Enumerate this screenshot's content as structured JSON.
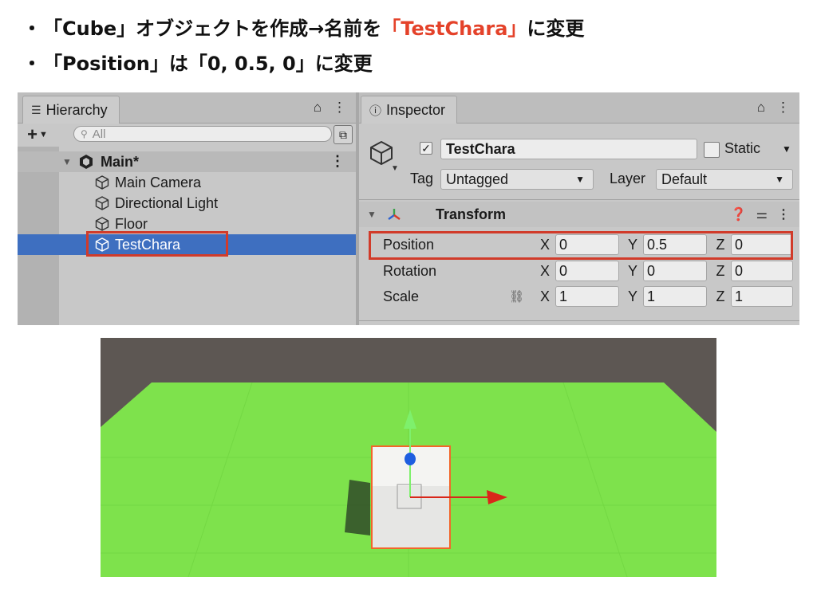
{
  "instructions": {
    "line1": {
      "bullet": "・",
      "text_before": "「Cube」オブジェクトを作成→名前を",
      "highlight": "「TestChara」",
      "text_after": "に変更"
    },
    "line2": {
      "bullet": "・",
      "text": "「Position」は「0, 0.5, 0」に変更"
    },
    "highlight_color": "#e4422a"
  },
  "hierarchy": {
    "tab_label": "Hierarchy",
    "tab_icon": "list-icon",
    "lock_glyph": "⌂",
    "menu_glyph": "⋮",
    "add_label": "+",
    "search_placeholder": "All",
    "scene_name": "Main*",
    "items": [
      {
        "label": "Main Camera",
        "icon": "cube-icon"
      },
      {
        "label": "Directional Light",
        "icon": "cube-icon"
      },
      {
        "label": "Floor",
        "icon": "cube-icon"
      },
      {
        "label": "TestChara",
        "icon": "cube-icon",
        "selected": true
      }
    ],
    "selection_color": "#3e6fc0"
  },
  "inspector": {
    "tab_label": "Inspector",
    "tab_icon": "info-icon",
    "object_name": "TestChara",
    "active_check": "✓",
    "static_label": "Static",
    "tag_label": "Tag",
    "tag_value": "Untagged",
    "layer_label": "Layer",
    "layer_value": "Default",
    "transform": {
      "title": "Transform",
      "rows": [
        {
          "label": "Position",
          "x": "0",
          "y": "0.5",
          "z": "0",
          "highlighted": true
        },
        {
          "label": "Rotation",
          "x": "0",
          "y": "0",
          "z": "0"
        },
        {
          "label": "Scale",
          "x": "1",
          "y": "1",
          "z": "1"
        }
      ],
      "axis_labels": [
        "X",
        "Y",
        "Z"
      ]
    }
  },
  "scene_view": {
    "floor_color": "#7ee24c",
    "background_color": "#5d5753",
    "cube_color": "#ececea",
    "outline_color": "#f2662a",
    "gizmo": {
      "y_axis_color": "#7ef06c",
      "x_axis_color": "#d9261a",
      "z_axis_color": "#1e5ee0"
    }
  },
  "accent_box_color": "#d13b2a"
}
